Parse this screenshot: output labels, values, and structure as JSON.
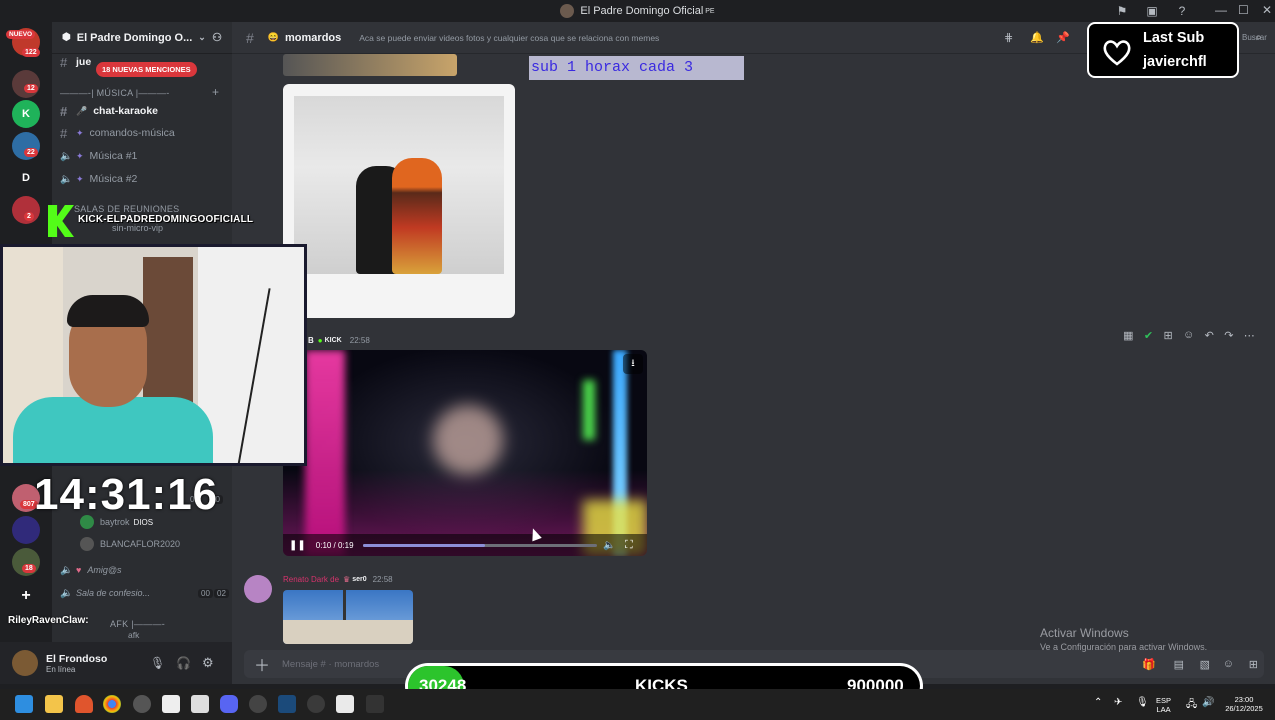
{
  "window": {
    "title": "El Padre Domingo Oficial",
    "title_suffix": "PE",
    "controls": [
      "—",
      "☐",
      "✕"
    ]
  },
  "server": {
    "name": "El Padre Domingo O...",
    "mention_pill": "18 NUEVAS MENCIONES",
    "rail_badges": [
      {
        "label": "NUEVO"
      },
      {
        "count": "122"
      },
      {
        "count": "12"
      },
      {
        "count": "22"
      },
      {
        "letter": "D"
      },
      {
        "count": "2"
      },
      {
        "count": "807"
      },
      {
        "count": "18"
      }
    ]
  },
  "channels": {
    "top_item": "jue",
    "category_music": "———-| MÚSICA |———-",
    "items": [
      {
        "name": "chat-karaoke",
        "type": "text",
        "bright": true
      },
      {
        "name": "comandos-música",
        "type": "text",
        "bright": false
      },
      {
        "name": "Música #1",
        "type": "voice",
        "bright": false
      },
      {
        "name": "Música #2",
        "type": "voice",
        "bright": false
      }
    ],
    "category_rooms": "SALAS DE REUNIONES",
    "room_item": "sin-micro-vip",
    "voice_users": [
      {
        "name": "baytrok",
        "badge": "DIOS"
      },
      {
        "name": "BLANCAFLOR2020",
        "badge": ""
      }
    ],
    "voice_count_a": "02",
    "voice_count_b": "20",
    "lower_channels": [
      {
        "name": "Amig@s"
      },
      {
        "name": "Sala de confesio...",
        "count_a": "00",
        "count_b": "02"
      }
    ],
    "category_afk": "AFK |———-",
    "afk_item": "afk",
    "overlay_user": "RileyRavenClaw:"
  },
  "user": {
    "name": "El Frondoso",
    "status": "En línea"
  },
  "chat": {
    "channel": "momardos",
    "topic": "Aca se puede enviar videos fotos y cualquier cosa que se relaciona con memes",
    "search_placeholder": "Buscar",
    "message_video": {
      "author": "B",
      "badge": "KICK",
      "time": "22:58",
      "duration": "0:10 / 0:19",
      "progress": 0.52
    },
    "message_next": {
      "author": "Renato Dark de",
      "badge": "ser0",
      "time": "22:58"
    },
    "composer_placeholder": "Mensaje # · momardos"
  },
  "stream_overlay": {
    "sub_text": "sub  1 horax cada 3",
    "last_sub_label": "Last Sub",
    "last_sub_name": "javierchfl",
    "kick_channel": "KICK-ELPADREDOMINGOOFICIALL",
    "clock": "14:31:16",
    "kicks_current": "30248",
    "kicks_label": "KICKS",
    "kicks_goal": "900000"
  },
  "windows_activation": {
    "title": "Activar Windows",
    "subtitle": "Ve a Configuración para activar Windows."
  },
  "taskbar": {
    "lang": "ESP",
    "layout": "LAA",
    "time": "23:00",
    "date": "26/12/2025"
  },
  "colors": {
    "accent_red": "#da373c",
    "kick_green": "#53fc18",
    "discord_bg": "#313338"
  }
}
